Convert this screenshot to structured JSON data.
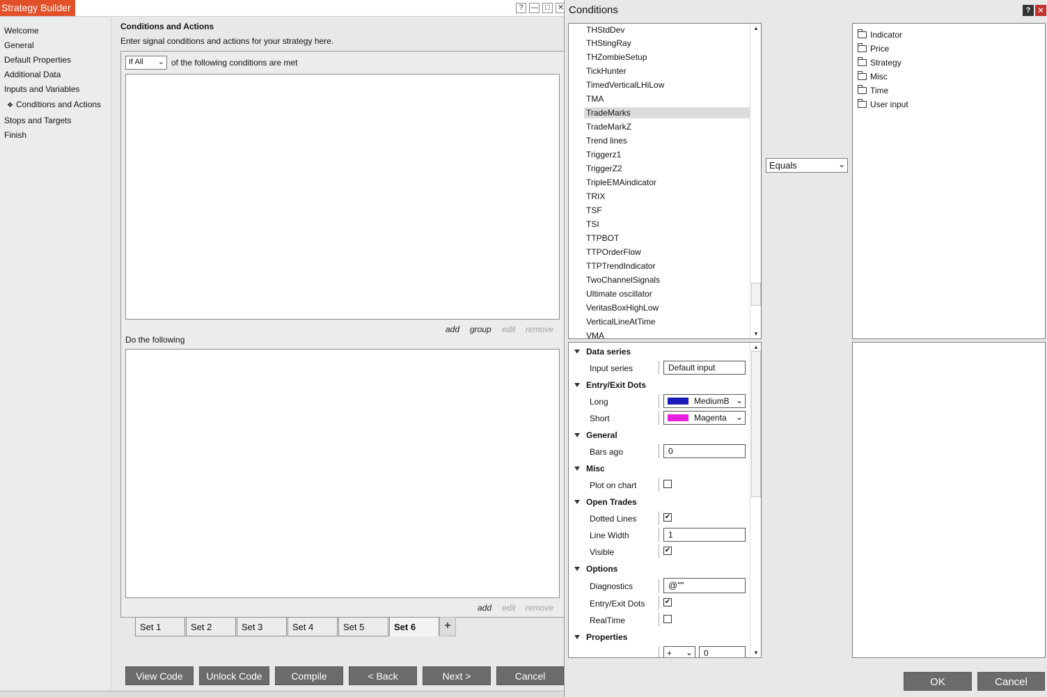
{
  "strategy_builder": {
    "title": "Strategy Builder",
    "window_buttons": {
      "help": "?",
      "minimize": "—",
      "maximize": "□",
      "close": "✕"
    },
    "nav": [
      {
        "label": "Welcome",
        "active": false
      },
      {
        "label": "General",
        "active": false
      },
      {
        "label": "Default Properties",
        "active": false
      },
      {
        "label": "Additional Data",
        "active": false
      },
      {
        "label": "Inputs and Variables",
        "active": false
      },
      {
        "label": "Conditions and Actions",
        "active": true,
        "marker": "❖"
      },
      {
        "label": "Stops and Targets",
        "active": false
      },
      {
        "label": "Finish",
        "active": false
      }
    ],
    "content": {
      "heading": "Conditions and Actions",
      "description": "Enter signal conditions and actions for your strategy here.",
      "condition_mode": "If All",
      "condition_suffix": "of the following conditions are met",
      "condition_links": {
        "add": "add",
        "group": "group",
        "edit": "edit",
        "remove": "remove"
      },
      "do_label": "Do the following",
      "action_links": {
        "add": "add",
        "edit": "edit",
        "remove": "remove"
      },
      "add_set": "+"
    },
    "sets": [
      "Set 1",
      "Set 2",
      "Set 3",
      "Set 4",
      "Set 5",
      "Set 6"
    ],
    "active_set": "Set 6",
    "buttons": {
      "view_code": "View Code",
      "unlock_code": "Unlock Code",
      "compile": "Compile",
      "back": "< Back",
      "next": "Next >",
      "cancel": "Cancel"
    }
  },
  "conditions_dialog": {
    "title": "Conditions",
    "help": "?",
    "close": "✕",
    "indicators": [
      "THStdDev",
      "THStingRay",
      "THZombieSetup",
      "TickHunter",
      "TimedVerticalLHiLow",
      "TMA",
      "TradeMarks",
      "TradeMarkZ",
      "Trend lines",
      "Triggerz1",
      "TriggerZ2",
      "TripleEMAindicator",
      "TRIX",
      "TSF",
      "TSI",
      "TTPBOT",
      "TTPOrderFlow",
      "TTPTrendIndicator",
      "TwoChannelSignals",
      "Ultimate oscillator",
      "VeritasBoxHighLow",
      "VerticalLineAtTime",
      "VMA"
    ],
    "selected_indicator": "TradeMarks",
    "operator": "Equals",
    "categories": [
      "Indicator",
      "Price",
      "Strategy",
      "Misc",
      "Time",
      "User input"
    ],
    "properties": {
      "data_series": {
        "group": "Data series",
        "input_series_label": "Input series",
        "input_series_value": "Default input"
      },
      "entry_exit_dots": {
        "group": "Entry/Exit Dots",
        "long_label": "Long",
        "long_value": "MediumB",
        "long_color": "#1a1ab8",
        "short_label": "Short",
        "short_value": "Magenta",
        "short_color": "#e81ee0"
      },
      "general": {
        "group": "General",
        "bars_ago_label": "Bars ago",
        "bars_ago_value": "0"
      },
      "misc": {
        "group": "Misc",
        "plot_on_chart_label": "Plot on chart",
        "plot_on_chart": false
      },
      "open_trades": {
        "group": "Open Trades",
        "dotted_lines_label": "Dotted Lines",
        "dotted_lines": true,
        "line_width_label": "Line Width",
        "line_width_value": "1",
        "visible_label": "Visible",
        "visible": true
      },
      "options": {
        "group": "Options",
        "diagnostics_label": "Diagnostics",
        "diagnostics_value": "@\"\"",
        "entry_exit_dots_label": "Entry/Exit Dots",
        "entry_exit_dots": true,
        "realtime_label": "RealTime",
        "realtime": false
      },
      "properties": {
        "group": "Properties",
        "offset_operator": "+",
        "offset_value": "0"
      }
    },
    "buttons": {
      "ok": "OK",
      "cancel": "Cancel"
    }
  }
}
